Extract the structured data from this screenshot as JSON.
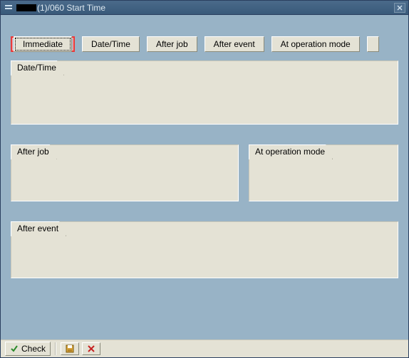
{
  "window": {
    "title_suffix": "(1)/060 Start Time"
  },
  "buttons": {
    "immediate": "Immediate",
    "date_time": "Date/Time",
    "after_job": "After job",
    "after_event": "After event",
    "at_op_mode": "At operation mode"
  },
  "groups": {
    "date_time": "Date/Time",
    "after_job": "After job",
    "at_op_mode": "At operation mode",
    "after_event": "After event"
  },
  "footer": {
    "check": "Check"
  }
}
